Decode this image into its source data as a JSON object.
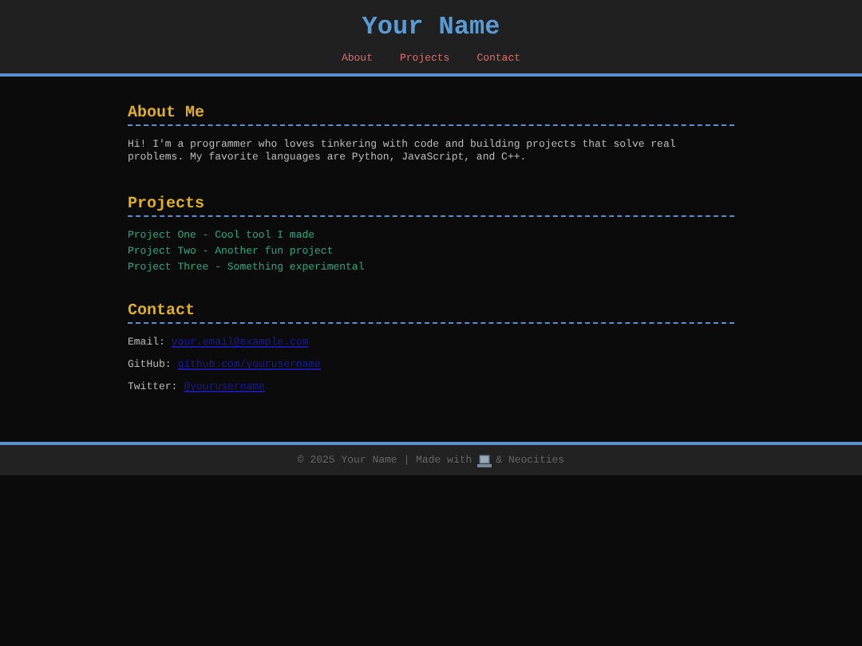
{
  "header": {
    "title": "Your Name",
    "nav": [
      "About",
      "Projects",
      "Contact"
    ]
  },
  "about": {
    "heading": "About Me",
    "text": "Hi! I'm a programmer who loves tinkering with code and building projects that solve real problems. My favorite languages are Python, JavaScript, and C++."
  },
  "projects": {
    "heading": "Projects",
    "items": [
      "Project One - Cool tool I made",
      "Project Two - Another fun project",
      "Project Three - Something experimental"
    ]
  },
  "contact": {
    "heading": "Contact",
    "items": [
      {
        "label": "Email:",
        "link": "your.email@example.com"
      },
      {
        "label": "GitHub:",
        "link": "github.com/yourusername"
      },
      {
        "label": "Twitter:",
        "link": "@yourusername"
      }
    ]
  },
  "footer": {
    "before_icon": "© 2025 Your Name | Made with",
    "after_icon": "& Neocities"
  }
}
